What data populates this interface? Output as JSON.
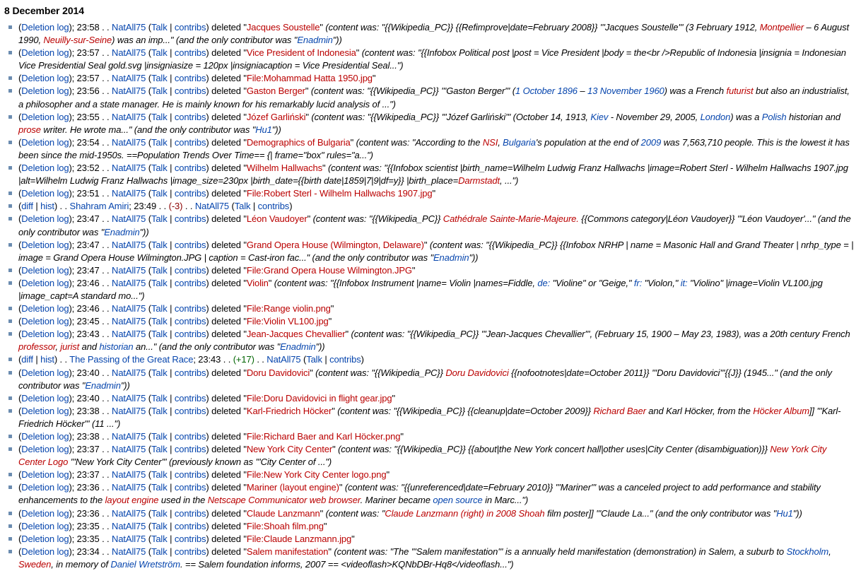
{
  "page": {
    "heading": "8 December 2014"
  },
  "colors": {
    "link": "#0645ad",
    "redlink": "#ba0000",
    "bullet": "#6b8cb0",
    "negative_change": "#8b0000",
    "positive_change": "#006400"
  },
  "labels": {
    "deletion_log": "Deletion log",
    "talk": "Talk",
    "contribs": "contribs",
    "diff": "diff",
    "hist": "hist",
    "deleted": "deleted",
    "user": "NatAll75"
  },
  "entries": [
    {
      "type": "deletion",
      "time": "23:58",
      "user": "NatAll75",
      "target": "Jacques Soustelle",
      "target_color": "red",
      "summary": [
        {
          "t": "(content was: \"{{Wikipedia_PC}} {{Refimprove|date=February 2008}} '''Jacques Soustelle''' (3 February 1912, "
        },
        {
          "t": "Montpellier",
          "c": "red"
        },
        {
          "t": " – 6 August 1990, "
        },
        {
          "t": "Neuilly-sur-Seine",
          "c": "red"
        },
        {
          "t": ") was an imp...\" (and the only contributor was \""
        },
        {
          "t": "Enadmin",
          "c": "blue"
        },
        {
          "t": "\"))"
        }
      ]
    },
    {
      "type": "deletion",
      "time": "23:57",
      "user": "NatAll75",
      "target": "Vice President of Indonesia",
      "target_color": "red",
      "summary": [
        {
          "t": "(content was: \"{{Infobox Political post |post = Vice President |body = the<br />Republic of Indonesia |insignia = Indonesian Vice Presidential Seal gold.svg |insigniasize = 120px |insigniacaption = Vice Presidential Seal...\")"
        }
      ]
    },
    {
      "type": "deletion",
      "time": "23:57",
      "user": "NatAll75",
      "target": "File:Mohammad Hatta 1950.jpg",
      "target_color": "red",
      "summary": []
    },
    {
      "type": "deletion",
      "time": "23:56",
      "user": "NatAll75",
      "target": "Gaston Berger",
      "target_color": "red",
      "summary": [
        {
          "t": "(content was: \"{{Wikipedia_PC}} '''Gaston Berger''' ("
        },
        {
          "t": "1 October 1896",
          "c": "blue"
        },
        {
          "t": " – "
        },
        {
          "t": "13 November 1960",
          "c": "blue"
        },
        {
          "t": ") was a French "
        },
        {
          "t": "futurist",
          "c": "red"
        },
        {
          "t": " but also an industrialist, a philosopher and a state manager. He is mainly known for his remarkably lucid analysis of ...\")"
        }
      ]
    },
    {
      "type": "deletion",
      "time": "23:55",
      "user": "NatAll75",
      "target": "Józef Garliński",
      "target_color": "red",
      "summary": [
        {
          "t": "(content was: \"{{Wikipedia_PC}} '''Józef Garliński''' (October 14, 1913, "
        },
        {
          "t": "Kiev",
          "c": "blue"
        },
        {
          "t": " - November 29, 2005, "
        },
        {
          "t": "London",
          "c": "blue"
        },
        {
          "t": ") was a "
        },
        {
          "t": "Polish",
          "c": "blue"
        },
        {
          "t": " historian and "
        },
        {
          "t": "prose",
          "c": "red"
        },
        {
          "t": " writer. He wrote ma...\" (and the only contributor was \""
        },
        {
          "t": "Hu1",
          "c": "blue"
        },
        {
          "t": "\"))"
        }
      ]
    },
    {
      "type": "deletion",
      "time": "23:54",
      "user": "NatAll75",
      "target": "Demographics of Bulgaria",
      "target_color": "red",
      "summary": [
        {
          "t": "(content was: \"According to the "
        },
        {
          "t": "NSI",
          "c": "red"
        },
        {
          "t": ", "
        },
        {
          "t": "Bulgaria",
          "c": "blue"
        },
        {
          "t": "'s population at the end of "
        },
        {
          "t": "2009",
          "c": "blue"
        },
        {
          "t": " was 7,563,710 people. This is the lowest it has been since the mid-1950s. ==Population Trends Over Time== {| frame=\"box\" rules=\"a...\")"
        }
      ]
    },
    {
      "type": "deletion",
      "time": "23:52",
      "user": "NatAll75",
      "target": "Wilhelm Hallwachs",
      "target_color": "red",
      "summary": [
        {
          "t": "(content was: \"{{Infobox scientist |birth_name=Wilhelm Ludwig Franz Hallwachs |image=Robert Sterl - Wilhelm Hallwachs 1907.jpg |alt=Wilhelm Ludwig Franz Hallwachs |image_size=230px |birth_date={{birth date|1859|7|9|df=y}} |birth_place="
        },
        {
          "t": "Darmstadt",
          "c": "red"
        },
        {
          "t": ", ...\")"
        }
      ]
    },
    {
      "type": "deletion",
      "time": "23:51",
      "user": "NatAll75",
      "target": "File:Robert Sterl - Wilhelm Hallwachs 1907.jpg",
      "target_color": "red",
      "summary": []
    },
    {
      "type": "edit",
      "page": "Shahram Amiri",
      "time": "23:49",
      "change": "(-3)",
      "change_sign": "neg",
      "user": "NatAll75"
    },
    {
      "type": "deletion",
      "time": "23:47",
      "user": "NatAll75",
      "target": "Léon Vaudoyer",
      "target_color": "red",
      "summary": [
        {
          "t": "(content was: \"{{Wikipedia_PC}} "
        },
        {
          "t": "Cathédrale Sainte-Marie-Majeure.",
          "c": "red"
        },
        {
          "t": " {{Commons category|Léon Vaudoyer}} '''Léon Vaudoyer'...\" (and the only contributor was \""
        },
        {
          "t": "Enadmin",
          "c": "blue"
        },
        {
          "t": "\"))"
        }
      ]
    },
    {
      "type": "deletion",
      "time": "23:47",
      "user": "NatAll75",
      "target": "Grand Opera House (Wilmington, Delaware)",
      "target_color": "red",
      "summary": [
        {
          "t": "(content was: \"{{Wikipedia_PC}} {{Infobox NRHP | name = Masonic Hall and Grand Theater | nrhp_type = | image = Grand Opera House Wilmington.JPG | caption = Cast-iron fac...\" (and the only contributor was \""
        },
        {
          "t": "Enadmin",
          "c": "blue"
        },
        {
          "t": "\"))"
        }
      ]
    },
    {
      "type": "deletion",
      "time": "23:47",
      "user": "NatAll75",
      "target": "File:Grand Opera House Wilmington.JPG",
      "target_color": "red",
      "summary": []
    },
    {
      "type": "deletion",
      "time": "23:46",
      "user": "NatAll75",
      "target": "Violin",
      "target_color": "red",
      "summary": [
        {
          "t": "(content was: \"{{Infobox Instrument |name= Violin |names=Fiddle, "
        },
        {
          "t": "de:",
          "c": "blue"
        },
        {
          "t": " \"Violine\" or \"Geige,\" "
        },
        {
          "t": "fr:",
          "c": "blue"
        },
        {
          "t": " \"Violon,\" "
        },
        {
          "t": "it:",
          "c": "blue"
        },
        {
          "t": " \"Violino\" |image=Violin VL100.jpg |image_capt=A standard mo...\")"
        }
      ]
    },
    {
      "type": "deletion",
      "time": "23:46",
      "user": "NatAll75",
      "target": "File:Range violin.png",
      "target_color": "red",
      "summary": []
    },
    {
      "type": "deletion",
      "time": "23:45",
      "user": "NatAll75",
      "target": "File:Violin VL100.jpg",
      "target_color": "red",
      "summary": []
    },
    {
      "type": "deletion",
      "time": "23:43",
      "user": "NatAll75",
      "target": "Jean-Jacques Chevallier",
      "target_color": "red",
      "summary": [
        {
          "t": "(content was: \"{{Wikipedia_PC}} '''Jean-Jacques Chevallier''', (February 15, 1900 – May 23, 1983), was a 20th century French "
        },
        {
          "t": "professor",
          "c": "red"
        },
        {
          "t": ", "
        },
        {
          "t": "jurist",
          "c": "red"
        },
        {
          "t": " and "
        },
        {
          "t": "historian",
          "c": "blue"
        },
        {
          "t": " an...\" (and the only contributor was \""
        },
        {
          "t": "Enadmin",
          "c": "blue"
        },
        {
          "t": "\"))"
        }
      ]
    },
    {
      "type": "edit",
      "page": "The Passing of the Great Race",
      "time": "23:43",
      "change": "(+17)",
      "change_sign": "pos",
      "user": "NatAll75"
    },
    {
      "type": "deletion",
      "time": "23:40",
      "user": "NatAll75",
      "target": "Doru Davidovici",
      "target_color": "red",
      "summary": [
        {
          "t": "(content was: \"{{Wikipedia_PC}} "
        },
        {
          "t": "Doru Davidovici",
          "c": "red"
        },
        {
          "t": " {{nofootnotes|date=October 2011}} '''Doru Davidovici'''{{J}} (1945...\" (and the only contributor was \""
        },
        {
          "t": "Enadmin",
          "c": "blue"
        },
        {
          "t": "\"))"
        }
      ]
    },
    {
      "type": "deletion",
      "time": "23:40",
      "user": "NatAll75",
      "target": "File:Doru Davidovici in flight gear.jpg",
      "target_color": "red",
      "summary": []
    },
    {
      "type": "deletion",
      "time": "23:38",
      "user": "NatAll75",
      "target": "Karl-Friedrich Höcker",
      "target_color": "red",
      "summary": [
        {
          "t": "(content was: \"{{Wikipedia_PC}} {{cleanup|date=October 2009}} "
        },
        {
          "t": "Richard Baer",
          "c": "red"
        },
        {
          "t": " and Karl Höcker, from the "
        },
        {
          "t": "Höcker Album",
          "c": "red"
        },
        {
          "t": "]] '''Karl-Friedrich Höcker''' (11 ...\")"
        }
      ]
    },
    {
      "type": "deletion",
      "time": "23:38",
      "user": "NatAll75",
      "target": "File:Richard Baer and Karl Höcker.png",
      "target_color": "red",
      "summary": []
    },
    {
      "type": "deletion",
      "time": "23:37",
      "user": "NatAll75",
      "target": "New York City Center",
      "target_color": "red",
      "summary": [
        {
          "t": "(content was: \"{{Wikipedia_PC}} {{about|the New York concert hall|other uses|City Center (disambiguation)}} "
        },
        {
          "t": "New York City Center Logo",
          "c": "red"
        },
        {
          "t": " '''New York City Center''' (previously known as '''City Center of ...\")"
        }
      ]
    },
    {
      "type": "deletion",
      "time": "23:37",
      "user": "NatAll75",
      "target": "File:New York City Center logo.png",
      "target_color": "red",
      "summary": []
    },
    {
      "type": "deletion",
      "time": "23:36",
      "user": "NatAll75",
      "target": "Mariner (layout engine)",
      "target_color": "red",
      "summary": [
        {
          "t": "(content was: \"{{unreferenced|date=February 2010}} '''Mariner''' was a canceled project to add performance and stability enhancements to the "
        },
        {
          "t": "layout engine",
          "c": "red"
        },
        {
          "t": " used in the "
        },
        {
          "t": "Netscape Communicator web browser",
          "c": "red"
        },
        {
          "t": ". Mariner became "
        },
        {
          "t": "open source",
          "c": "blue"
        },
        {
          "t": " in Marc...\")"
        }
      ]
    },
    {
      "type": "deletion",
      "time": "23:36",
      "user": "NatAll75",
      "target": "Claude Lanzmann",
      "target_color": "red",
      "summary": [
        {
          "t": "(content was: \""
        },
        {
          "t": "Claude Lanzmann (right) in 2008 Shoah",
          "c": "red"
        },
        {
          "t": " film poster]] '''Claude La...\" (and the only contributor was \""
        },
        {
          "t": "Hu1",
          "c": "blue"
        },
        {
          "t": "\"))"
        }
      ]
    },
    {
      "type": "deletion",
      "time": "23:35",
      "user": "NatAll75",
      "target": "File:Shoah film.png",
      "target_color": "red",
      "summary": []
    },
    {
      "type": "deletion",
      "time": "23:35",
      "user": "NatAll75",
      "target": "File:Claude Lanzmann.jpg",
      "target_color": "red",
      "summary": []
    },
    {
      "type": "deletion",
      "time": "23:34",
      "user": "NatAll75",
      "target": "Salem manifestation",
      "target_color": "red",
      "summary": [
        {
          "t": "(content was: \"The '''Salem manifestation''' is a annually held manifestation (demonstration) in Salem, a suburb to "
        },
        {
          "t": "Stockholm",
          "c": "blue"
        },
        {
          "t": ", "
        },
        {
          "t": "Sweden",
          "c": "red"
        },
        {
          "t": ", in memory of "
        },
        {
          "t": "Daniel Wretström",
          "c": "blue"
        },
        {
          "t": ". == Salem foundation informs, 2007 == <videoflash>KQNbDBr-Hq8</videoflash...\")"
        }
      ]
    }
  ]
}
